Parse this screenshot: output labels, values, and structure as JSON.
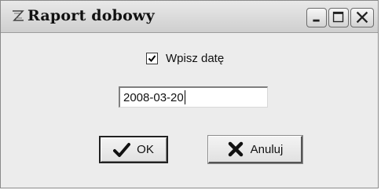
{
  "window": {
    "title": "Raport dobowy",
    "icon": "app-z-icon",
    "controls": {
      "minimize": "minimize-icon",
      "maximize": "maximize-icon",
      "close": "close-icon"
    }
  },
  "form": {
    "checkbox": {
      "label": "Wpisz datę",
      "checked": true
    },
    "date_input": {
      "value": "2008-03-20"
    }
  },
  "buttons": {
    "ok": {
      "label": "OK",
      "icon": "checkmark-icon"
    },
    "cancel": {
      "label": "Anuluj",
      "icon": "x-mark-icon"
    }
  }
}
